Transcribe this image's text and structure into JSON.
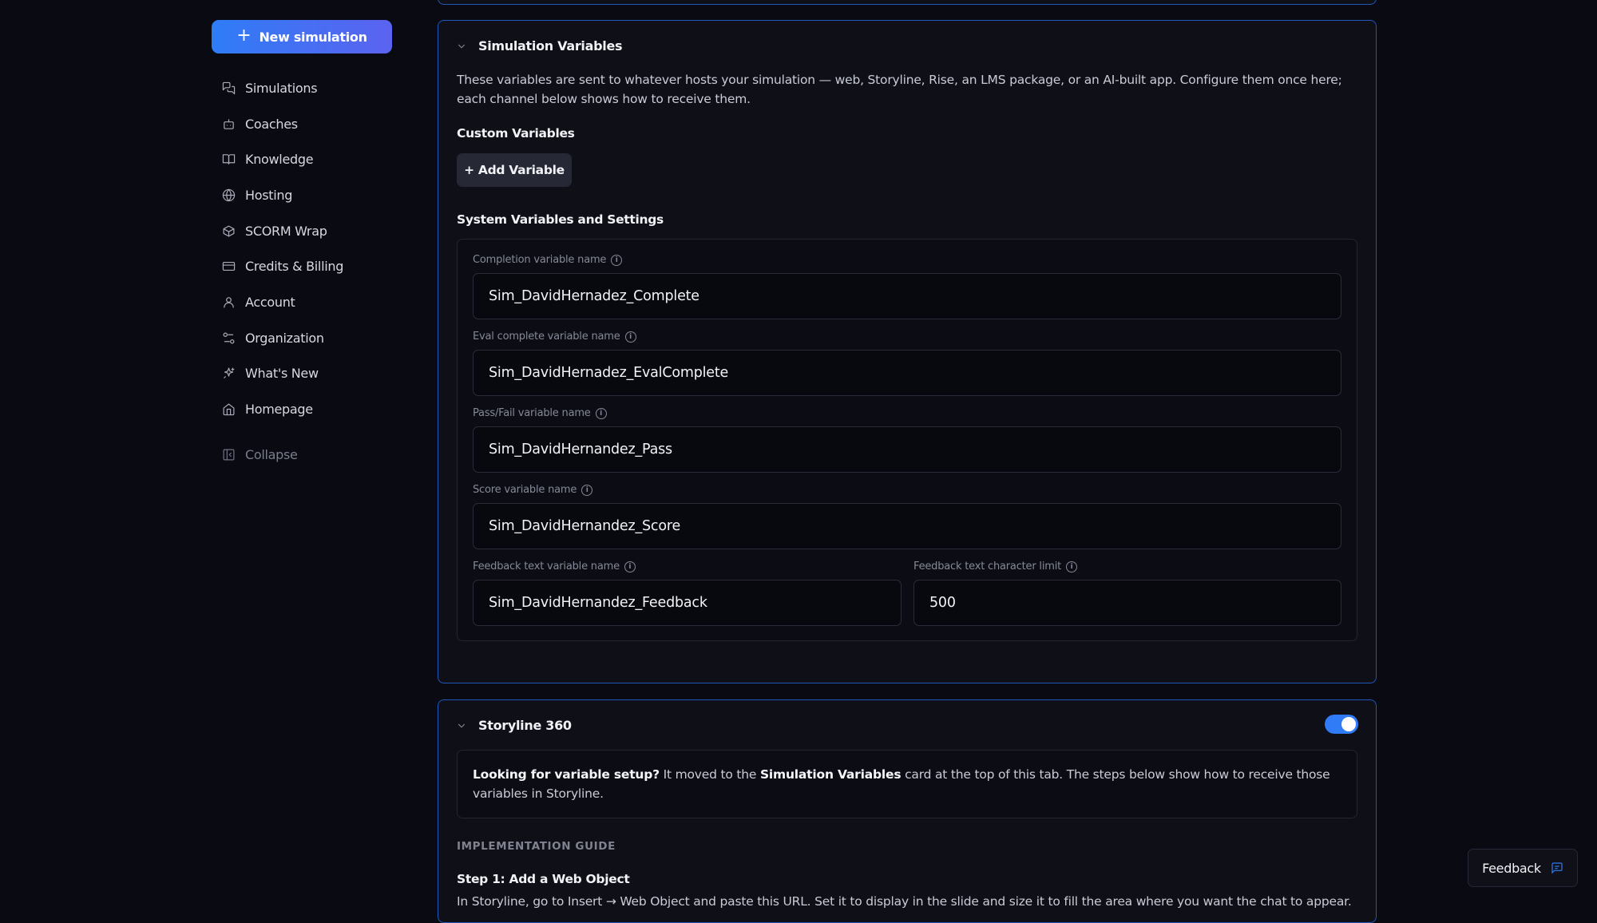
{
  "sidebar": {
    "new_simulation_label": "New simulation",
    "items": [
      {
        "label": "Simulations",
        "icon": "chat-icon"
      },
      {
        "label": "Coaches",
        "icon": "bot-icon"
      },
      {
        "label": "Knowledge",
        "icon": "book-icon"
      },
      {
        "label": "Hosting",
        "icon": "globe-icon"
      },
      {
        "label": "SCORM Wrap",
        "icon": "package-icon"
      },
      {
        "label": "Credits & Billing",
        "icon": "credit-card-icon"
      },
      {
        "label": "Account",
        "icon": "user-icon"
      },
      {
        "label": "Organization",
        "icon": "org-icon"
      },
      {
        "label": "What's New",
        "icon": "sparkles-icon"
      },
      {
        "label": "Homepage",
        "icon": "home-icon"
      }
    ],
    "collapse_label": "Collapse"
  },
  "sim_vars": {
    "title": "Simulation Variables",
    "description": "These variables are sent to whatever hosts your simulation — web, Storyline, Rise, an LMS package, or an AI-built app. Configure them once here; each channel below shows how to receive them.",
    "custom_title": "Custom Variables",
    "add_variable_label": "+ Add Variable",
    "system_title": "System Variables and Settings",
    "fields": {
      "completion": {
        "label": "Completion variable name",
        "value": "Sim_DavidHernadez_Complete"
      },
      "eval_complete": {
        "label": "Eval complete variable name",
        "value": "Sim_DavidHernadez_EvalComplete"
      },
      "pass_fail": {
        "label": "Pass/Fail variable name",
        "value": "Sim_DavidHernandez_Pass"
      },
      "score": {
        "label": "Score variable name",
        "value": "Sim_DavidHernandez_Score"
      },
      "feedback_text": {
        "label": "Feedback text variable name",
        "value": "Sim_DavidHernandez_Feedback"
      },
      "char_limit": {
        "label": "Feedback text character limit",
        "value": "500"
      }
    }
  },
  "storyline": {
    "title": "Storyline 360",
    "enabled": true,
    "notice_bold_1": "Looking for variable setup?",
    "notice_text_1": " It moved to the ",
    "notice_bold_2": "Simulation Variables",
    "notice_text_2": " card at the top of this tab. The steps below show how to receive those variables in Storyline.",
    "guide_heading": "IMPLEMENTATION GUIDE",
    "step1_title": "Step 1: Add a Web Object",
    "step1_text": "In Storyline, go to Insert → Web Object and paste this URL. Set it to display in the slide and size it to fill the area where you want the chat to appear."
  },
  "feedback_label": "Feedback",
  "colors": {
    "accent": "#2f7cf6",
    "border": "#1f58b8",
    "background": "#090a12"
  }
}
